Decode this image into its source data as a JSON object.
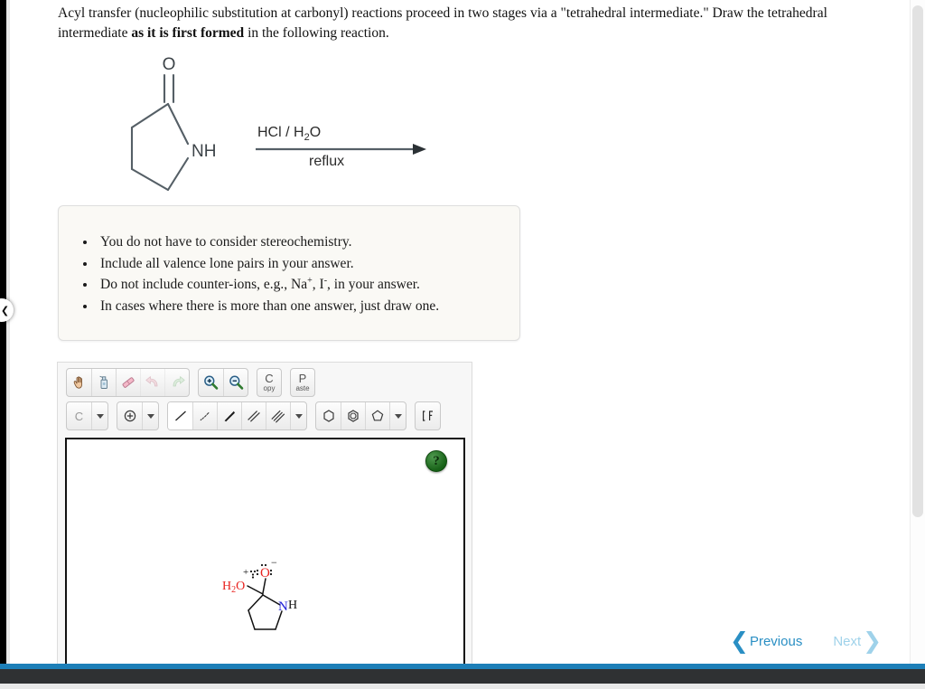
{
  "prompt": {
    "part1": "Acyl transfer (nucleophilic substitution at carbonyl) reactions proceed in two stages via a \"tetrahedral intermediate.\" Draw the tetrahedral intermediate ",
    "bold": "as it is first formed",
    "part2": " in the following reaction."
  },
  "reaction": {
    "reactant_name": "2-pyrrolidinone",
    "reactant_labels": {
      "carbonyl_o": "O",
      "amine": "NH"
    },
    "conditions_top": "HCl / H",
    "conditions_top_sub": "2",
    "conditions_top_end": "O",
    "conditions_bottom": "reflux"
  },
  "instructions": {
    "bullets": [
      {
        "text": "You do not have to consider stereochemistry."
      },
      {
        "text": "Include all valence lone pairs in your answer."
      },
      {
        "pre": "Do not include counter-ions, e.g., Na",
        "sup1": "+",
        "mid": ", I",
        "sup2": "-",
        "post": ", in your answer."
      },
      {
        "text": "In cases where there is more than one answer, just draw one."
      }
    ]
  },
  "editor": {
    "toolbar_top": [
      {
        "name": "pan-hand-tool",
        "title": "Pan"
      },
      {
        "name": "eraser-spray-tool",
        "title": "Clear"
      },
      {
        "name": "eraser-tool",
        "title": "Eraser"
      },
      {
        "name": "undo-tool",
        "title": "Undo"
      },
      {
        "name": "redo-tool",
        "title": "Redo"
      },
      {
        "name": "zoom-in-tool",
        "title": "Zoom In"
      },
      {
        "name": "zoom-out-tool",
        "title": "Zoom Out"
      }
    ],
    "copy_label_big": "C",
    "copy_label_small": "opy",
    "paste_label_big": "P",
    "paste_label_small": "aste",
    "element_label": "C",
    "toolbar_bond": [
      {
        "name": "single-bond-tool",
        "selected": true
      },
      {
        "name": "hash-bond-tool",
        "selected": false
      },
      {
        "name": "wedge-bond-tool",
        "selected": false
      },
      {
        "name": "double-bond-tool",
        "selected": false
      },
      {
        "name": "triple-bond-tool",
        "selected": false
      }
    ],
    "toolbar_ring": [
      {
        "name": "cyclohexane-ring-tool"
      },
      {
        "name": "benzene-ring-tool"
      },
      {
        "name": "cyclopentane-ring-tool"
      }
    ],
    "help_glyph": "?"
  },
  "answer": {
    "labels": {
      "water": "H",
      "water_sub": "2",
      "water_end": "O",
      "oxygen": "O",
      "plus_charge": "+",
      "minus_charge": "−",
      "nitrogen": "N",
      "hydrogen": "H"
    },
    "colors": {
      "oxygen": "#e8221f",
      "nitrogen": "#2020d8",
      "bond": "#111111"
    }
  },
  "nav": {
    "previous": "Previous",
    "next": "Next",
    "prev_chevron": "❮",
    "next_chevron": "❯"
  },
  "colors": {
    "accent_blue": "#1d7fb8",
    "link_blue": "#2a8fc4",
    "link_blue_disabled": "#9fd2ea",
    "footer_dark": "#2f3133",
    "panel_bg": "#f7f7f7",
    "instr_bg": "#faf9f5"
  }
}
